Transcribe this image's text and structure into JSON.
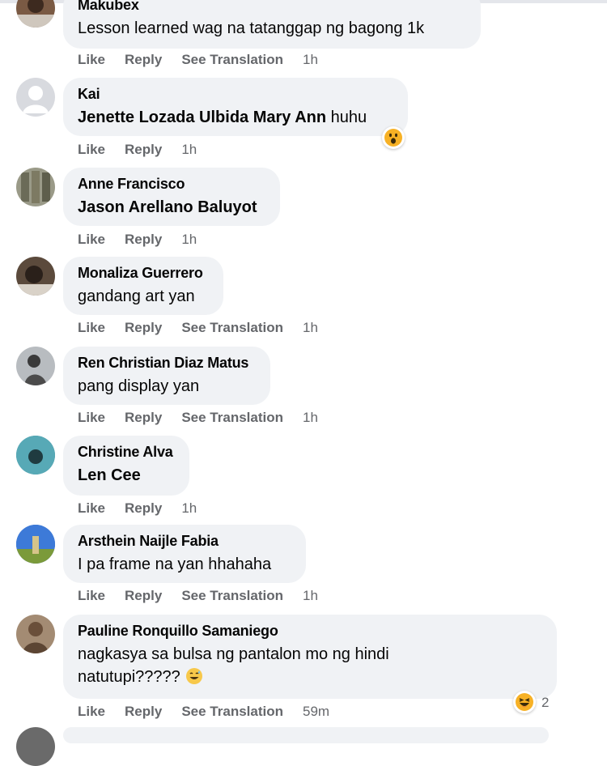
{
  "comments": [
    {
      "name": "Makubex",
      "text": "Lesson learned wag na tatanggap ng bagong 1k",
      "actions": {
        "like": "Like",
        "reply": "Reply",
        "translate": "See Translation",
        "time": "1h"
      }
    },
    {
      "name": "Kai",
      "mention": "Jenette Lozada Ulbida Mary Ann",
      "text": "huhu",
      "reaction": "wow-icon",
      "actions": {
        "like": "Like",
        "reply": "Reply",
        "time": "1h"
      }
    },
    {
      "name": "Anne Francisco",
      "mention": "Jason Arellano Baluyot",
      "actions": {
        "like": "Like",
        "reply": "Reply",
        "time": "1h"
      }
    },
    {
      "name": "Monaliza Guerrero",
      "text": "gandang art yan",
      "actions": {
        "like": "Like",
        "reply": "Reply",
        "translate": "See Translation",
        "time": "1h"
      }
    },
    {
      "name": "Ren Christian Diaz Matus",
      "text": "pang display yan",
      "actions": {
        "like": "Like",
        "reply": "Reply",
        "translate": "See Translation",
        "time": "1h"
      }
    },
    {
      "name": "Christine Alva",
      "mention": "Len Cee",
      "actions": {
        "like": "Like",
        "reply": "Reply",
        "time": "1h"
      }
    },
    {
      "name": "Arsthein Naijle Fabia",
      "text": "I pa frame na yan hhahaha",
      "actions": {
        "like": "Like",
        "reply": "Reply",
        "translate": "See Translation",
        "time": "1h"
      }
    },
    {
      "name": "Pauline Ronquillo Samaniego",
      "text_line1": "nagkasya sa bulsa ng pantalon mo ng hindi",
      "text_line2": "natutupi?????",
      "inline_emoji": "grinning-sweat-icon",
      "reaction": "haha-icon",
      "reaction_count": "2",
      "actions": {
        "like": "Like",
        "reply": "Reply",
        "translate": "See Translation",
        "time": "59m"
      }
    }
  ],
  "colors": {
    "bubble": "#f0f2f5",
    "meta": "#65676b",
    "text": "#050505",
    "emoji": "#f7b125"
  }
}
